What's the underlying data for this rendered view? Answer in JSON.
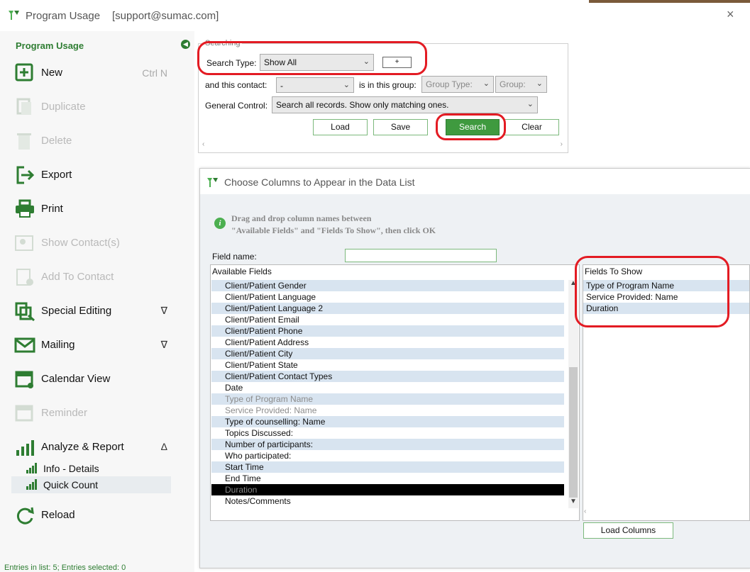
{
  "window": {
    "title": "Program Usage",
    "user": "[support@sumac.com]",
    "close_glyph": "×"
  },
  "sidebar": {
    "section_title": "Program Usage",
    "items": [
      {
        "label": "New",
        "shortcut": "Ctrl N",
        "icon": "plus-box-icon",
        "enabled": true
      },
      {
        "label": "Duplicate",
        "icon": "duplicate-icon",
        "enabled": false
      },
      {
        "label": "Delete",
        "icon": "trash-icon",
        "enabled": false
      },
      {
        "label": "Export",
        "icon": "export-icon",
        "enabled": true
      },
      {
        "label": "Print",
        "icon": "printer-icon",
        "enabled": true
      },
      {
        "label": "Show Contact(s)",
        "icon": "contacts-icon",
        "enabled": false
      },
      {
        "label": "Add To Contact",
        "icon": "add-contact-icon",
        "enabled": false
      },
      {
        "label": "Special Editing",
        "icon": "special-edit-icon",
        "enabled": true,
        "caret": "∇"
      },
      {
        "label": "Mailing",
        "icon": "mail-icon",
        "enabled": true,
        "caret": "∇"
      },
      {
        "label": "Calendar View",
        "icon": "calendar-icon",
        "enabled": true
      },
      {
        "label": "Reminder",
        "icon": "reminder-icon",
        "enabled": false
      },
      {
        "label": "Analyze & Report",
        "icon": "chart-icon",
        "enabled": true,
        "caret": "Δ"
      },
      {
        "label": "Reload",
        "icon": "reload-icon",
        "enabled": true
      }
    ],
    "sub_items": [
      "Info - Details",
      "Quick Count"
    ],
    "status": "Entries in list: 5; Entries selected: 0"
  },
  "search": {
    "legend": "Searching",
    "search_type_label": "Search Type:",
    "search_type_value": "Show All",
    "plus_label": "+",
    "contact_label": "and this contact:",
    "contact_value": "-",
    "group_label": "is in this group:",
    "group_type_placeholder": "Group Type:",
    "group_placeholder": "Group:",
    "general_label": "General Control:",
    "general_value": "Search all records. Show only matching ones.",
    "buttons": {
      "load": "Load",
      "save": "Save",
      "search": "Search",
      "clear": "Clear"
    }
  },
  "dialog": {
    "title": "Choose Columns to Appear in the Data List",
    "info_line1": "Drag and drop column names between",
    "info_line2": "\"Available Fields\" and \"Fields To Show\", then click OK",
    "field_name_label": "Field name:",
    "field_name_value": "",
    "available_header": "Available Fields",
    "available_fields": [
      {
        "label": "Client/Patient Gender",
        "state": "alt"
      },
      {
        "label": "Client/Patient Language",
        "state": ""
      },
      {
        "label": "Client/Patient Language 2",
        "state": "alt"
      },
      {
        "label": "Client/Patient Email",
        "state": ""
      },
      {
        "label": "Client/Patient Phone",
        "state": "alt"
      },
      {
        "label": "Client/Patient Address",
        "state": ""
      },
      {
        "label": "Client/Patient City",
        "state": "alt"
      },
      {
        "label": "Client/Patient State",
        "state": ""
      },
      {
        "label": "Client/Patient Contact Types",
        "state": "alt"
      },
      {
        "label": "Date",
        "state": ""
      },
      {
        "label": "Type of Program Name",
        "state": "alt dim"
      },
      {
        "label": "Service Provided: Name",
        "state": "dim"
      },
      {
        "label": "Type of counselling: Name",
        "state": "alt"
      },
      {
        "label": "Topics Discussed:",
        "state": ""
      },
      {
        "label": "Number of participants:",
        "state": "alt"
      },
      {
        "label": "Who participated:",
        "state": ""
      },
      {
        "label": "Start Time",
        "state": "alt"
      },
      {
        "label": "End Time",
        "state": ""
      },
      {
        "label": "Duration",
        "state": "sel"
      },
      {
        "label": "Notes/Comments",
        "state": ""
      }
    ],
    "show_header": "Fields To Show",
    "show_fields": [
      "Type of Program Name",
      "Service Provided: Name",
      "Duration"
    ],
    "load_columns_label": "Load Columns"
  },
  "colors": {
    "brand_green": "#2e7d32",
    "button_green": "#3f9a3f",
    "highlight_red": "#e31b23",
    "row_alt": "#d8e4f0"
  }
}
